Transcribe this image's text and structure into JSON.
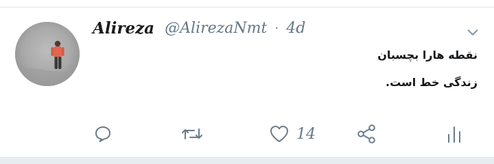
{
  "tweet": {
    "author_name": "Alireza",
    "handle": "@AlirezaNmt",
    "separator": "·",
    "age": "4d",
    "text_lines": [
      "نقطه هارا بچسبان",
      "زندگی خط است."
    ],
    "like_count": "14"
  },
  "icons": {
    "avatar": "avatar-photo",
    "more": "chevron-down-icon",
    "reply": "reply-icon",
    "retweet": "retweet-icon",
    "like": "heart-icon",
    "share": "share-icon",
    "stats": "stats-icon"
  },
  "colors": {
    "text": "#14171a",
    "muted": "#657786",
    "divider": "#e6ecf0"
  }
}
